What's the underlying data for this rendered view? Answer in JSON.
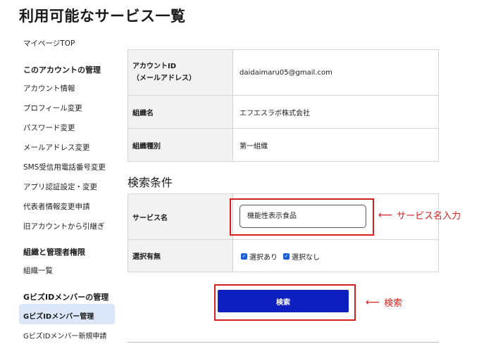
{
  "page": {
    "title": "利用可能なサービス一覧"
  },
  "sidebar": {
    "top_link": "マイページTOP",
    "account_heading": "このアカウントの管理",
    "account_items": [
      "アカウント情報",
      "プロフィール変更",
      "パスワード変更",
      "メールアドレス変更",
      "SMS受信用電話番号変更",
      "アプリ認証設定・変更",
      "代表者情報変更申請",
      "旧アカウントから引継ぎ"
    ],
    "org_heading": "組織と管理者権限",
    "org_items": [
      "組織一覧"
    ],
    "member_heading": "GビズIDメンバーの管理",
    "member_items": [
      "GビズIDメンバー管理",
      "GビズIDメンバー新規申請"
    ]
  },
  "info": {
    "rows": [
      {
        "label_line1": "アカウントID",
        "label_line2": "（メールアドレス）",
        "value": "daidaimaru05@gmail.com"
      },
      {
        "label": "組織名",
        "value": "エフエスラボ株式会社"
      },
      {
        "label": "組織種別",
        "value": "第一組織"
      }
    ]
  },
  "search": {
    "section_title": "検索条件",
    "service_label": "サービス名",
    "service_value": "機能性表示食品",
    "selection_label": "選択有無",
    "options": [
      {
        "label": "選択あり",
        "checked": true
      },
      {
        "label": "選択なし",
        "checked": true
      }
    ],
    "button_label": "検索"
  },
  "annotations": {
    "service_note": "サービス名入力",
    "search_note": "検索",
    "color": "#d62020"
  },
  "colors": {
    "button": "#0e1fbf",
    "active_nav": "#dbe6f8",
    "checkbox": "#1a5fd6"
  }
}
